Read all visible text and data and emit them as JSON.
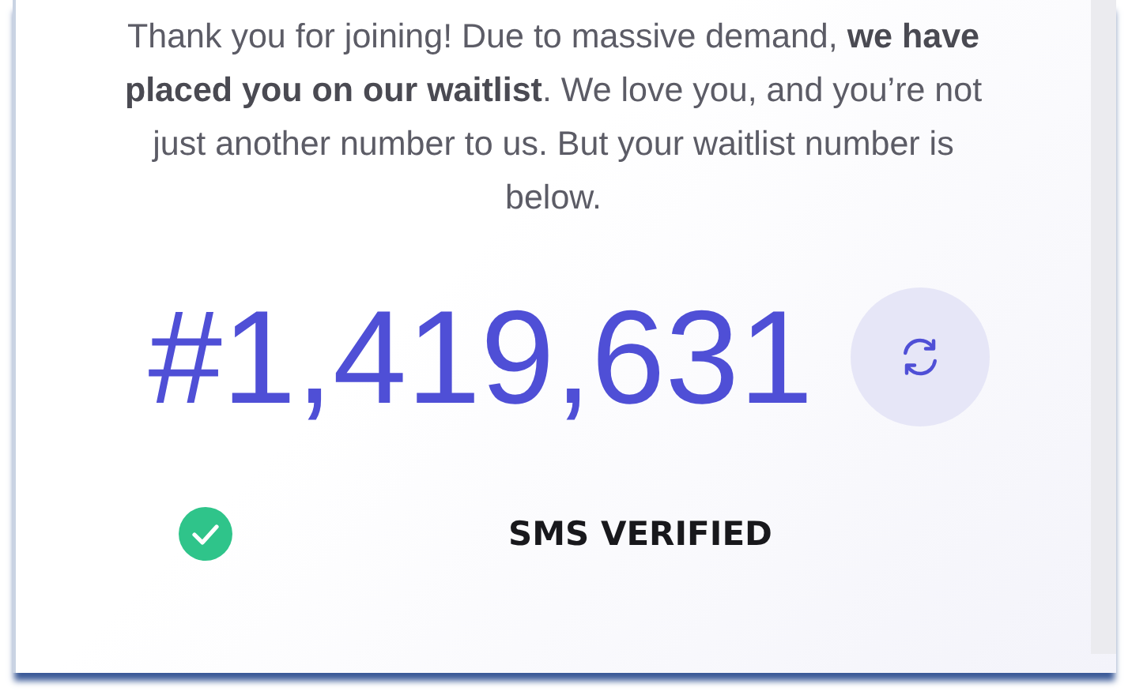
{
  "message": "Thank you for joining! Due to massive demand, **we have placed you on our waitlist**. We love you, and you’re not just another number to us. But your waitlist number is below.",
  "waitlist_number": "#1,419,631",
  "sms_status": {
    "label": "SMS VERIFIED",
    "verified": true
  }
}
